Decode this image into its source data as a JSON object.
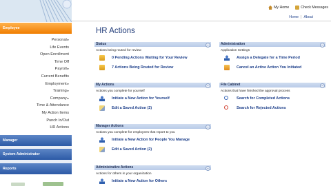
{
  "sidebar": {
    "employee_header": "Employee",
    "items": [
      {
        "label": "Personal",
        "arrow": "▸"
      },
      {
        "label": "Life Events",
        "arrow": ""
      },
      {
        "label": "Open Enrollment",
        "arrow": ""
      },
      {
        "label": "Time Off",
        "arrow": ""
      },
      {
        "label": "Payroll",
        "arrow": "▸"
      },
      {
        "label": "Current Benefits",
        "arrow": ""
      },
      {
        "label": "Employment",
        "arrow": "▸"
      },
      {
        "label": "Training",
        "arrow": "▸"
      },
      {
        "label": "Company",
        "arrow": "▸"
      },
      {
        "label": "Time & Attendance",
        "arrow": ""
      },
      {
        "label": "My Action Items",
        "arrow": ""
      },
      {
        "label": "Punch In/Out",
        "arrow": ""
      },
      {
        "label": "HR Actions",
        "arrow": ""
      }
    ],
    "manager_header": "Manager",
    "sysadmin_header": "System Administrator",
    "reports_header": "Reports"
  },
  "topbar": {
    "my_home": "My Home",
    "check_messages": "Check Messages",
    "home_link": "Home",
    "separator": "|",
    "about_link": "About"
  },
  "page_title": "HR Actions",
  "panels": {
    "status": {
      "title": "Status",
      "desc": "Actions being routed for review",
      "items": [
        {
          "label": "0 Pending Actions Waiting for Your Review",
          "icon": "folder-icon"
        },
        {
          "label": "7 Actions Being Routed for Review",
          "icon": "folder-icon"
        }
      ]
    },
    "my_actions": {
      "title": "My Actions",
      "desc": "Actions you complete for yourself",
      "items": [
        {
          "label": "Initiate a New Action for Yourself",
          "icon": "person-icon"
        },
        {
          "label": "Edit a Saved Action (2)",
          "icon": "edit-icon"
        }
      ]
    },
    "manager_actions": {
      "title": "Manager Actions",
      "desc": "Actions you complete for employees that report to you",
      "items": [
        {
          "label": "Initiate a New Action for People You Manage",
          "icon": "person-icon"
        },
        {
          "label": "Edit a Saved Action (2)",
          "icon": "edit-icon"
        }
      ]
    },
    "admin_actions": {
      "title": "Administrative Actions",
      "desc": "Actions for others in your organization",
      "items": [
        {
          "label": "Initiate a New Action for Others",
          "icon": "person-icon"
        }
      ]
    },
    "administration": {
      "title": "Administration",
      "desc": "Application Settings",
      "items": [
        {
          "label": "Assign a Delegate for a Time Period",
          "icon": "person-icon"
        },
        {
          "label": "Cancel an Active Action You Initiated",
          "icon": "folder-icon"
        }
      ]
    },
    "file_cabinet": {
      "title": "File Cabinet",
      "desc": "Actions that have finished the approval process",
      "items": [
        {
          "label": "Search for Completed Actions",
          "icon": "search-icon"
        },
        {
          "label": "Search for Rejected Actions",
          "icon": "search-icon"
        }
      ]
    }
  },
  "collapse_symbol": "−"
}
